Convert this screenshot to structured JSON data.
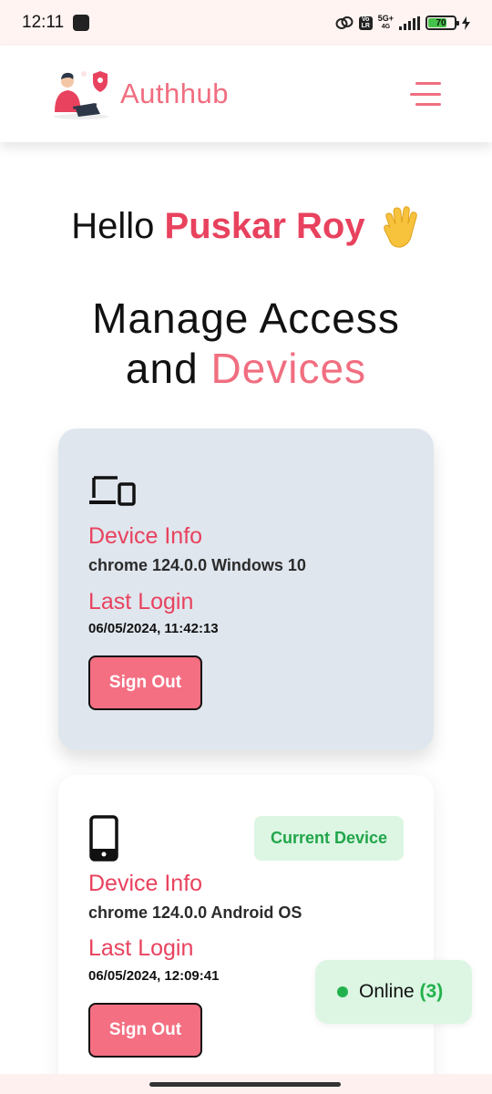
{
  "status_bar": {
    "time": "12:11",
    "network_top": "5G+",
    "network_bottom": "4G",
    "volte": "Vo LR",
    "battery": "70",
    "battery_level": 0.7
  },
  "header": {
    "brand": "Authhub",
    "menu_icon": "hamburger-icon"
  },
  "greeting": {
    "hello": "Hello",
    "name": "Puskar Roy",
    "emoji_icon": "waving-hand-icon"
  },
  "heading": {
    "line1": "Manage Access",
    "line2_plain": "and",
    "line2_accent": "Devices"
  },
  "devices": [
    {
      "icon": "laptop-phone-icon",
      "info_label": "Device Info",
      "info_value": "chrome 124.0.0 Windows 10",
      "login_label": "Last Login",
      "login_value": "06/05/2024, 11:42:13",
      "button": "Sign Out"
    },
    {
      "icon": "smartphone-icon",
      "badge": "Current Device",
      "info_label": "Device Info",
      "info_value": "chrome 124.0.0 Android OS",
      "login_label": "Last Login",
      "login_value": "06/05/2024, 12:09:41",
      "button": "Sign Out"
    }
  ],
  "online": {
    "label": "Online",
    "count": "(3)"
  },
  "colors": {
    "accent": "#e8425e",
    "brand_pink": "#f06e80",
    "button": "#f46f82",
    "success": "#22b24c",
    "card_bg": "#e0e6ee"
  }
}
